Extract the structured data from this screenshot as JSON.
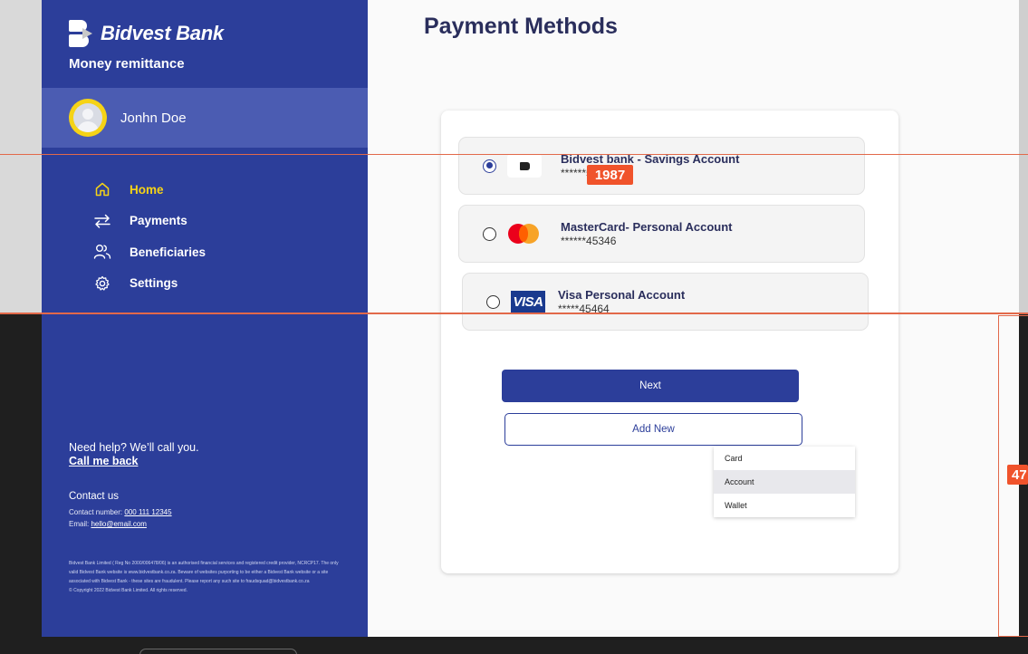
{
  "sidebar": {
    "brand_name": "Bidvest Bank",
    "brand_subtitle": "Money remittance",
    "user_name": "Jonhn Doe",
    "nav": [
      {
        "label": "Home",
        "icon": "home-icon",
        "active": true
      },
      {
        "label": "Payments",
        "icon": "transfer-arrows-icon",
        "active": false
      },
      {
        "label": "Beneficiaries",
        "icon": "users-icon",
        "active": false
      },
      {
        "label": "Settings",
        "icon": "gear-icon",
        "active": false
      }
    ],
    "help_text": "Need help? We’ll call you.",
    "call_me_back": "Call me back",
    "contact_title": "Contact us",
    "contact_number_label": "Contact number: ",
    "contact_number": "000 111 12345",
    "email_label": "Email: ",
    "email": "hello@email.com",
    "legal_text": "Bidvest Bank Limited ( Reg No 2000/006478/06) is an authorised financial services and registered credit provider, NCRCP17. The only valid Bidvest Bank website is www.bidvestbank.co.za. Beware of websites purporting to be either a Bidvest Bank website or a site associated with Bidvest Bank - these sites are fraudulent. Please report any such site to fraudsquad@bidvestbank.co.za",
    "copyright": "© Copyright 2022 Bidvest Bank Limited. All rights reserved."
  },
  "main": {
    "title": "Payment Methods",
    "accounts": [
      {
        "name": "Bidvest bank - Savings Account",
        "number": "******5",
        "logo": "bidvest-logo",
        "selected": true
      },
      {
        "name": "MasterCard- Personal Account",
        "number": "******45346",
        "logo": "mastercard-logo",
        "selected": false
      },
      {
        "name": "Visa Personal Account",
        "number": "*****45464",
        "logo": "visa-logo",
        "logo_text": "VISA",
        "selected": false
      }
    ],
    "next_label": "Next",
    "add_new_label": "Add New",
    "add_new_options": [
      "Card",
      "Account",
      "Wallet"
    ],
    "highlighted_option": "Account"
  },
  "annotations": {
    "badge_1": "1987",
    "badge_2": "47"
  },
  "colors": {
    "brand_blue": "#2c3e9a",
    "active_yellow": "#f5d316",
    "title_navy": "#2a2e5c",
    "annotation_red": "#f0532b"
  }
}
